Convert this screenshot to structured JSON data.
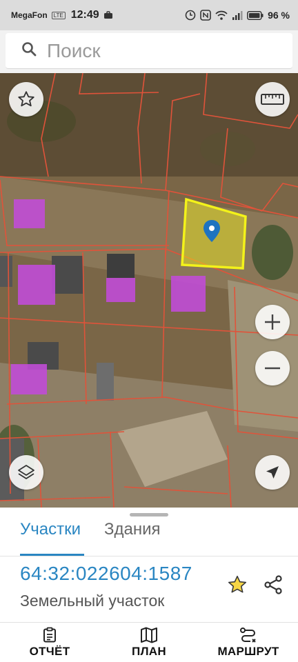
{
  "status_bar": {
    "carrier": "MegaFon",
    "carrier_badge": "LTE",
    "time": "12:49",
    "battery": "96 %"
  },
  "search": {
    "placeholder": "Поиск"
  },
  "tabs": [
    {
      "label": "Участки",
      "active": true
    },
    {
      "label": "Здания",
      "active": false
    }
  ],
  "parcel": {
    "cadastral_number": "64:32:022604:1587",
    "type": "Земельный участок"
  },
  "bottom_nav": [
    {
      "label": "ОТЧЁТ",
      "icon": "report-icon"
    },
    {
      "label": "ПЛАН",
      "icon": "map-icon"
    },
    {
      "label": "МАРШРУТ",
      "icon": "route-icon"
    }
  ],
  "colors": {
    "accent": "#2a86c2",
    "parcel_highlight": "#f3f21a",
    "building_fill": "#c04cd6",
    "boundary_line": "#e0533a"
  }
}
